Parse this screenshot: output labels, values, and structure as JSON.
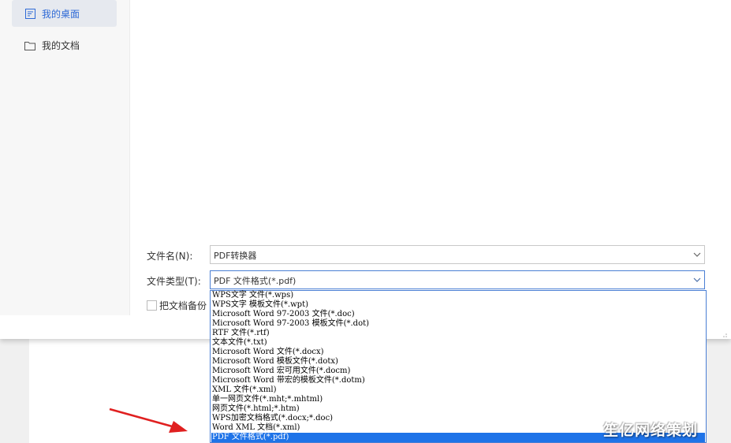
{
  "sidebar": {
    "items": [
      {
        "label": "我的桌面",
        "icon": "desktop-icon",
        "active": true
      },
      {
        "label": "我的文档",
        "icon": "folder-icon",
        "active": false
      }
    ]
  },
  "form": {
    "filename_label": "文件名(N):",
    "filename_value": "PDF转换器",
    "filetype_label": "文件类型(T):",
    "filetype_value": "PDF 文件格式(*.pdf)",
    "backup_label": "把文档备份"
  },
  "dropdown": {
    "options": [
      "WPS文字 文件(*.wps)",
      "WPS文字 模板文件(*.wpt)",
      "Microsoft Word 97-2003 文件(*.doc)",
      "Microsoft Word 97-2003 模板文件(*.dot)",
      "RTF 文件(*.rtf)",
      "文本文件(*.txt)",
      "Microsoft Word 文件(*.docx)",
      "Microsoft Word 模板文件(*.dotx)",
      "Microsoft Word 宏可用文件(*.docm)",
      "Microsoft Word 带宏的模板文件(*.dotm)",
      "XML 文件(*.xml)",
      "单一网页文件(*.mht;*.mhtml)",
      "网页文件(*.html;*.htm)",
      "WPS加密文档格式(*.docx;*.doc)",
      "Word XML 文档(*.xml)",
      "PDF 文件格式(*.pdf)"
    ],
    "selected_index": 15
  },
  "watermark": "笙亿网络策划",
  "colors": {
    "accent": "#2f6ad6",
    "selection": "#1e73e8",
    "annotation_arrow": "#e02020"
  }
}
